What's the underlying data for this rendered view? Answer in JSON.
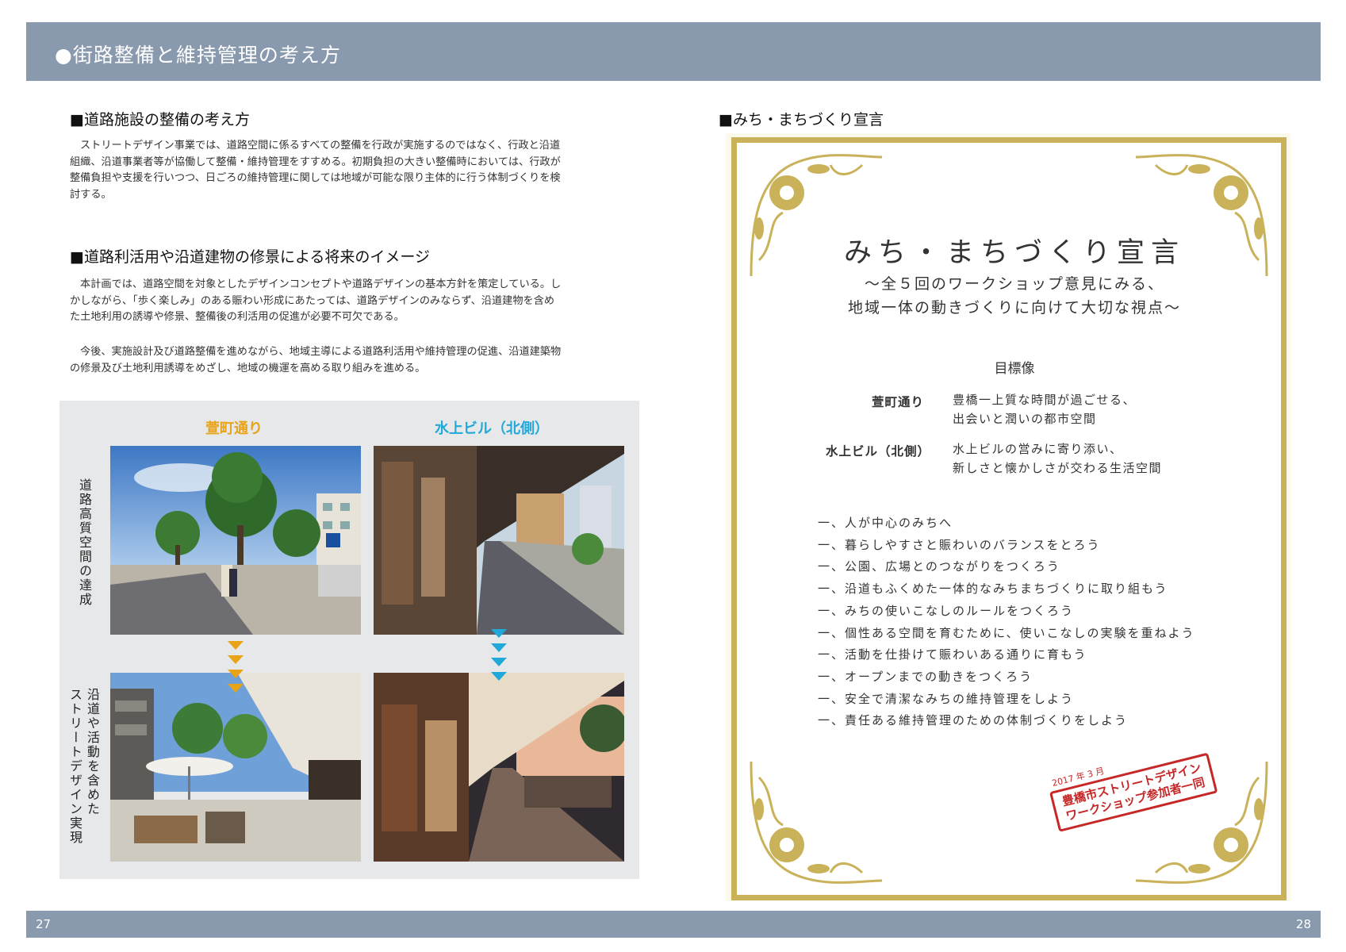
{
  "header": {
    "title": "●街路整備と維持管理の考え方"
  },
  "left": {
    "section1": {
      "heading": "■道路施設の整備の考え方",
      "lines": [
        "ストリートデザイン事業では、道路空間に係るすべての整備を行政が実施するのではなく、行政と沿道",
        "組織、沿道事業者等が協働して整備・維持管理をすすめる。初期負担の大きい整備時においては、行政が",
        "整備負担や支援を行いつつ、日ごろの維持管理に関しては地域が可能な限り主体的に行う体制づくりを検",
        "討する。"
      ]
    },
    "section2": {
      "heading": "■道路利活用や沿道建物の修景による将来のイメージ",
      "para1_lines": [
        "本計画では、道路空間を対象としたデザインコンセプトや道路デザインの基本方針を策定している。し",
        "かしながら、「歩く楽しみ」のある賑わい形成にあたっては、道路デザインのみならず、沿道建物を含め",
        "た土地利用の誘導や修景、整備後の利活用の促進が必要不可欠である。"
      ],
      "para2_lines": [
        "今後、実施設計及び道路整備を進めながら、地域主導による道路利活用や維持管理の促進、沿道建築物",
        "の修景及び土地利用誘導をめざし、地域の機運を高める取り組みを進める。"
      ]
    },
    "photos": {
      "col1_label": "萱町通り",
      "col2_label": "水上ビル（北側）",
      "row1_label": "道路高質空間の達成",
      "row2_label_a": "沿道や活動を含めた",
      "row2_label_b": "ストリートデザイン実現",
      "accent_orange": "#e8a317",
      "accent_blue": "#20a8d8"
    }
  },
  "right": {
    "heading": "■みち・まちづくり宣言",
    "declaration": {
      "title": "みち・まちづくり宣言",
      "subtitle1": "～全５回のワークショップ意見にみる、",
      "subtitle2": "地域一体の動きづくりに向けて大切な視点～",
      "goal_heading": "目標像",
      "goals": [
        {
          "label": "萱町通り",
          "line1": "豊橋一上質な時間が過ごせる、",
          "line2": "出会いと潤いの都市空間"
        },
        {
          "label": "水上ビル（北側）",
          "line1": "水上ビルの営みに寄り添い、",
          "line2": "新しさと懐かしさが交わる生活空間"
        }
      ],
      "tenets": [
        "一、人が中心のみちへ",
        "一、暮らしやすさと賑わいのバランスをとろう",
        "一、公園、広場とのつながりをつくろう",
        "一、沿道もふくめた一体的なみちまちづくりに取り組もう",
        "一、みちの使いこなしのルールをつくろう",
        "一、個性ある空間を育むために、使いこなしの実験を重ねよう",
        "一、活動を仕掛けて賑わいある通りに育もう",
        "一、オープンまでの動きをつくろう",
        "一、安全で清潔なみちの維持管理をしよう",
        "一、責任ある維持管理のための体制づくりをしよう"
      ],
      "stamp_date": "2017 年 3 月",
      "stamp_line1": "豊橋市ストリートデザイン",
      "stamp_line2": "ワークショップ参加者一同"
    }
  },
  "footer": {
    "page_left": "27",
    "page_right": "28"
  }
}
